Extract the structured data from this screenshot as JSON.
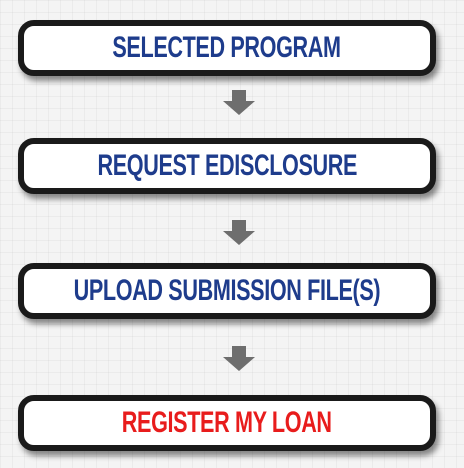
{
  "flow": {
    "steps": [
      {
        "label": "Selected Program",
        "highlight": false
      },
      {
        "label": "Request eDisclosure",
        "highlight": false
      },
      {
        "label": "Upload Submission File(s)",
        "highlight": false
      },
      {
        "label": "Register My Loan",
        "highlight": true
      }
    ],
    "colors": {
      "step_text": "#1e3c8c",
      "highlight_text": "#e81c1c",
      "box_border": "#1a1a1a",
      "arrow": "#6e6e6e"
    },
    "icons": [
      "arrow-down-icon",
      "arrow-down-icon",
      "arrow-down-icon"
    ]
  }
}
